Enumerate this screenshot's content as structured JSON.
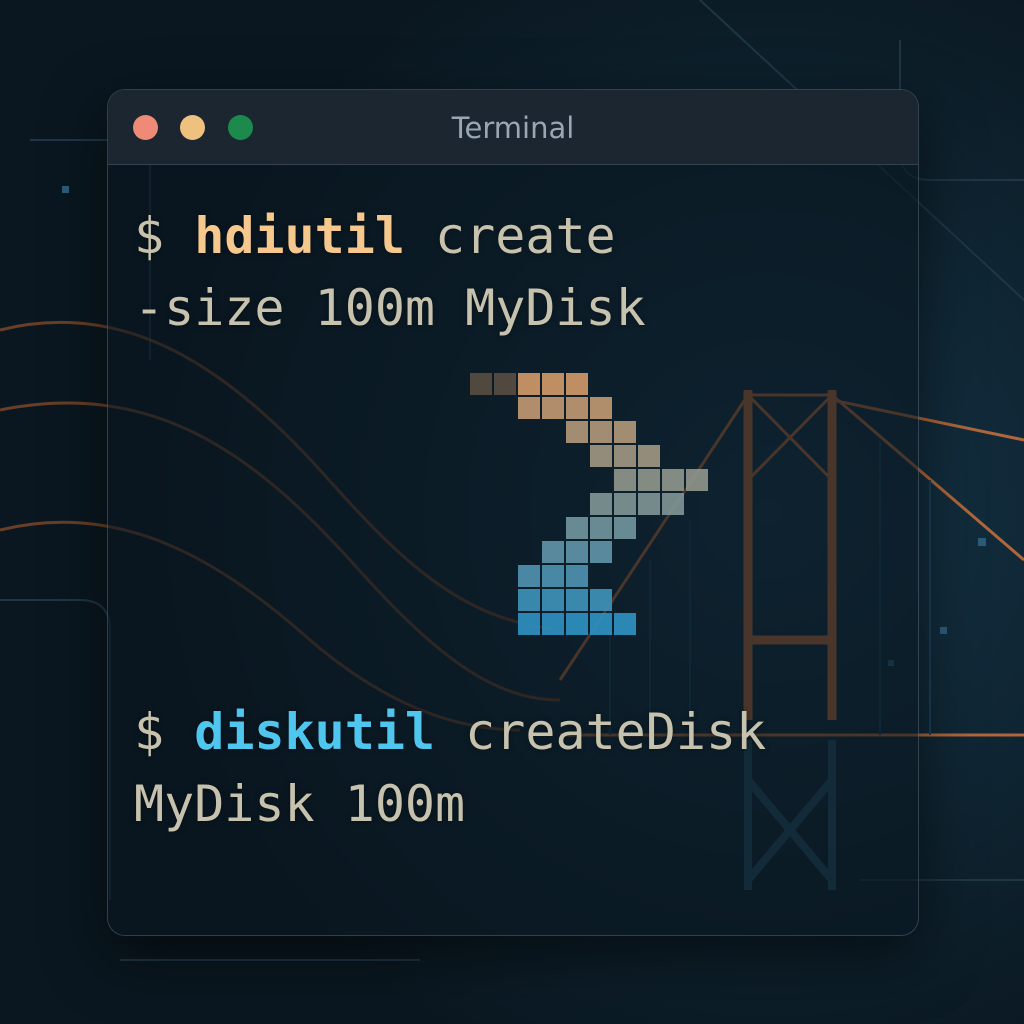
{
  "window": {
    "title": "Terminal"
  },
  "traffic_lights": {
    "close_color": "#ee8a76",
    "minimize_color": "#eec27e",
    "maximize_color": "#1d8a4d"
  },
  "colors": {
    "background": "#0c1a24",
    "text": "#c6c2ad",
    "hdiutil": "#f6c88e",
    "diskutil": "#4fc6ee",
    "bridge": "#b0663a",
    "arrow_top": "#d39b69",
    "arrow_bottom": "#2f92c3"
  },
  "icons": {
    "center_graphic": "pixel-arrow-icon",
    "background": "bridge-illustration"
  },
  "commands": [
    {
      "prompt": "$",
      "tool": "hdiutil",
      "args_line1": "create",
      "line2": "-size 100m MyDisk"
    },
    {
      "prompt": "$",
      "tool": "diskutil",
      "args_line1": "createDisk",
      "line2": "MyDisk 100m"
    }
  ]
}
